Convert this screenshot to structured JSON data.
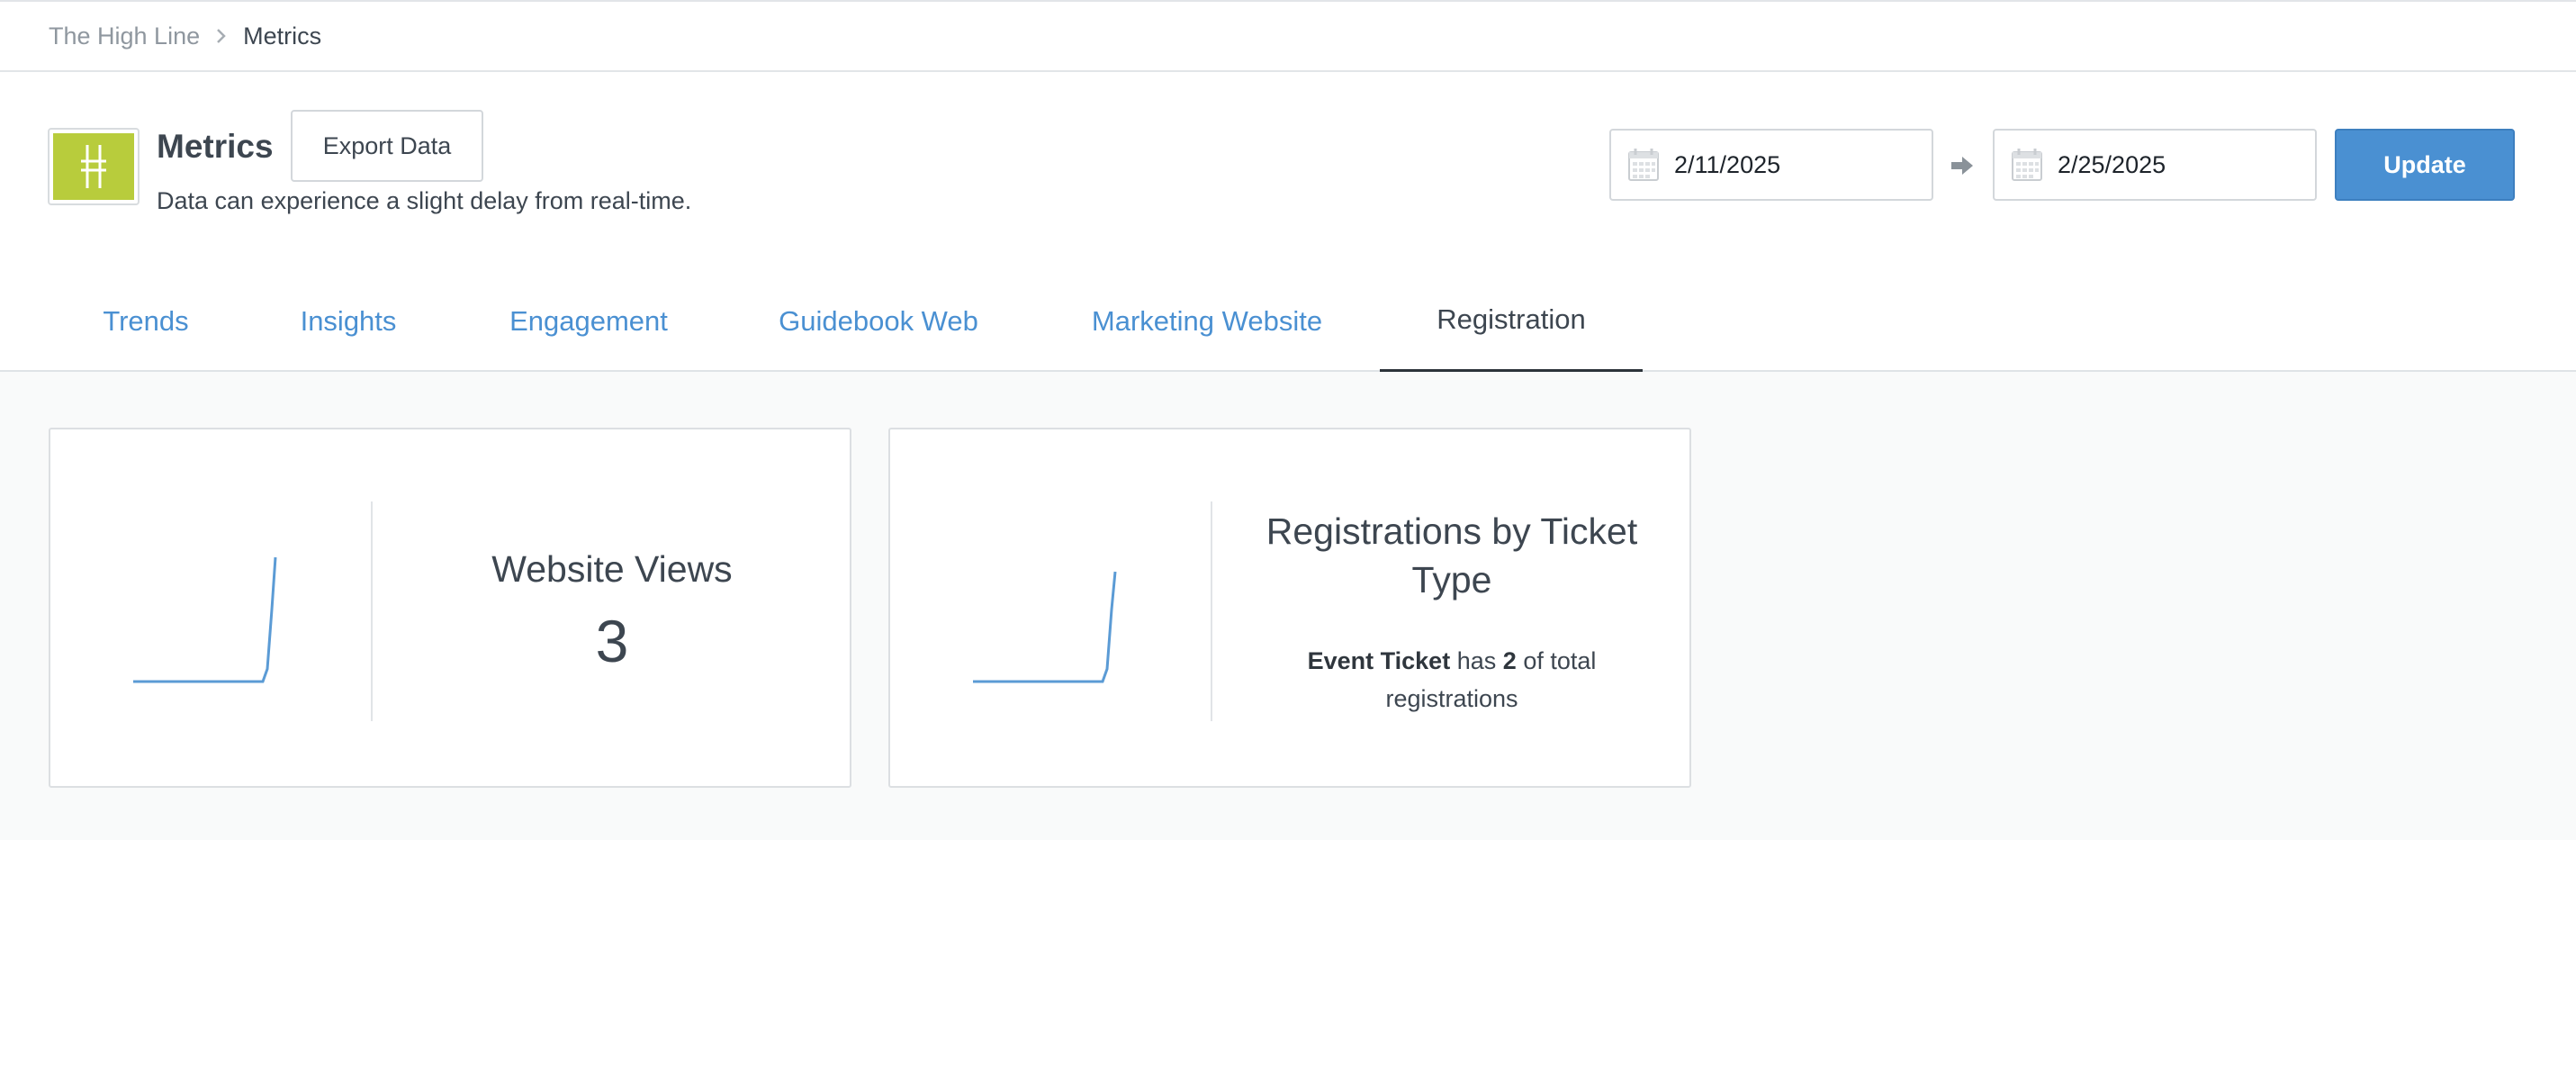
{
  "breadcrumb": {
    "parent": "The High Line",
    "current": "Metrics"
  },
  "header": {
    "title": "Metrics",
    "export_label": "Export Data",
    "subtitle": "Data can experience a slight delay from real-time.",
    "date_start": "2/11/2025",
    "date_end": "2/25/2025",
    "update_label": "Update",
    "logo_color": "#b8cc3c"
  },
  "tabs": [
    {
      "label": "Trends"
    },
    {
      "label": "Insights"
    },
    {
      "label": "Engagement"
    },
    {
      "label": "Guidebook Web"
    },
    {
      "label": "Marketing Website"
    },
    {
      "label": "Registration"
    }
  ],
  "active_tab": "Registration",
  "cards": {
    "website_views": {
      "title": "Website Views",
      "value": "3"
    },
    "registrations": {
      "title": "Registrations by Ticket Type",
      "ticket_name": "Event Ticket",
      "has_text": "has",
      "count": "2",
      "suffix": "of total registrations"
    }
  },
  "colors": {
    "accent": "#4a90d2",
    "text": "#3d4650",
    "sparkline": "#5b9bd5"
  }
}
